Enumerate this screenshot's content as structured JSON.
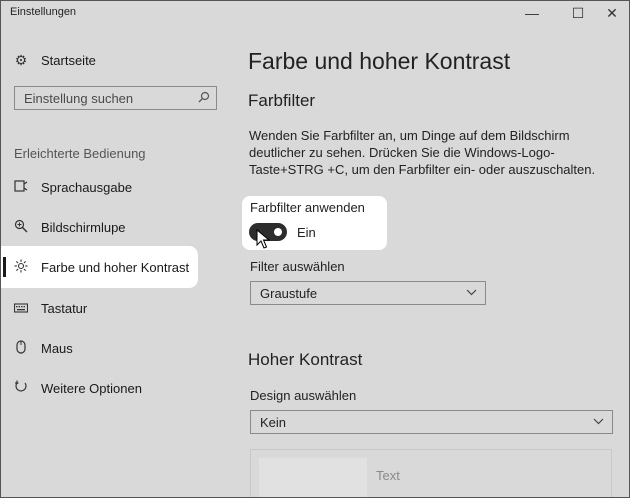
{
  "window": {
    "title": "Einstellungen"
  },
  "controls": {
    "minimize": "—",
    "maximize": "☐",
    "close": "✕"
  },
  "sidebar": {
    "home_label": "Startseite",
    "search_placeholder": "Einstellung suchen",
    "section_heading": "Erleichterte Bedienung",
    "items": [
      {
        "label": "Sprachausgabe",
        "icon": "narrator-icon"
      },
      {
        "label": "Bildschirmlupe",
        "icon": "magnifier-icon"
      },
      {
        "label": "Farbe und hoher Kontrast",
        "icon": "brightness-icon",
        "active": true
      },
      {
        "label": "Tastatur",
        "icon": "keyboard-icon"
      },
      {
        "label": "Maus",
        "icon": "mouse-icon"
      },
      {
        "label": "Weitere Optionen",
        "icon": "more-options-icon"
      }
    ]
  },
  "main": {
    "title": "Farbe und hoher Kontrast",
    "color_filter": {
      "heading": "Farbfilter",
      "description": "Wenden Sie Farbfilter an, um Dinge auf dem Bildschirm deutlicher zu sehen. Drücken Sie die Windows-Logo-Taste+STRG +C, um den Farbfilter ein- oder auszuschalten.",
      "toggle_label": "Farbfilter anwenden",
      "toggle_state": "Ein",
      "toggle_on": true,
      "filter_select_label": "Filter auswählen",
      "filter_value": "Graustufe"
    },
    "high_contrast": {
      "heading": "Hoher Kontrast",
      "design_label": "Design auswählen",
      "design_value": "Kein",
      "preview_text": "Text"
    }
  },
  "colors": {
    "background": "#d9d9d9",
    "toggle_on": "#2d2d2d",
    "highlight": "#ffffff"
  }
}
